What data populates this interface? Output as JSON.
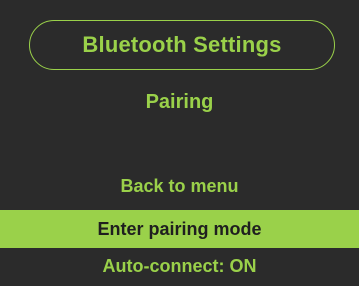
{
  "header": {
    "title": "Bluetooth Settings"
  },
  "section": {
    "title": "Pairing"
  },
  "menu": {
    "items": [
      {
        "label": "Back to menu",
        "selected": false
      },
      {
        "label": "Enter pairing mode",
        "selected": true
      },
      {
        "label": "Auto-connect: ON",
        "selected": false
      }
    ]
  },
  "colors": {
    "background": "#2b2b2b",
    "accent": "#9ad14a",
    "selected_text": "#1f1f1f"
  }
}
